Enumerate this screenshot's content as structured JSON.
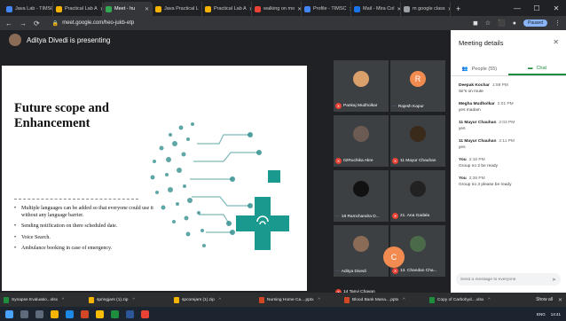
{
  "browser": {
    "tabs": [
      {
        "label": "Java Lab - TIMSC",
        "color": "#4285f4"
      },
      {
        "label": "Practical Lab A",
        "color": "#f4b400"
      },
      {
        "label": "Meet - hu",
        "color": "#34a853",
        "active": true
      },
      {
        "label": "Java Practical L",
        "color": "#f4b400"
      },
      {
        "label": "Practical Lab A",
        "color": "#f4b400"
      },
      {
        "label": "walking on mo",
        "color": "#ea4335"
      },
      {
        "label": "Profile - TIMSC",
        "color": "#4285f4"
      },
      {
        "label": "Mail - Mira Col",
        "color": "#1a73e8"
      },
      {
        "label": "m google class",
        "color": "#9aa0a6"
      }
    ],
    "url": "meet.google.com/heo-jukb-etp",
    "paused_label": "Paused"
  },
  "meeting": {
    "presenter_text": "Aditya Divedi is presenting"
  },
  "slide": {
    "title": "Future scope and Enhancement",
    "bullets": [
      "Multiple languages can be added so that everyone could use it without any language barrier.",
      "Sending notification on there scheduled date.",
      "Voice Search.",
      "Ambulance booking in case of emergency."
    ]
  },
  "participants": [
    {
      "name": "Pankaj Mudholkar",
      "avatar_color": "#d9a06b",
      "muted": true
    },
    {
      "name": "Rajesh Kapur",
      "avatar_color": "#f28b50",
      "initial": "R",
      "muted": false
    },
    {
      "name": "02Ruchika Akre",
      "avatar_color": "#6b5b53",
      "muted": true
    },
    {
      "name": "11 Mayur Chauhan",
      "avatar_color": "#3a2a1a",
      "muted": true
    },
    {
      "name": "18 Ramchandra D...",
      "avatar_color": "#111111",
      "muted": false
    },
    {
      "name": "21. Ana Gadala",
      "avatar_color": "#222222",
      "muted": true
    },
    {
      "name": "Aditya Divedi",
      "avatar_color": "#8a6b55",
      "muted": false
    },
    {
      "name": "13. Chandan Cha...",
      "avatar_color": "#4a6a4a",
      "muted": true
    },
    {
      "name": "14 Tanvi Chavan",
      "avatar_color": "#f28b50",
      "initial": "C",
      "muted": true
    }
  ],
  "panel": {
    "title": "Meeting details",
    "people_tab": "People (55)",
    "chat_tab": "Chat",
    "messages": [
      {
        "sender": "Deepak Kochar",
        "time": "1:59 PM",
        "text": "Sir's on mute"
      },
      {
        "sender": "Megha Mudholkar",
        "time": "2:01 PM",
        "text": "yes madam"
      },
      {
        "sender": "11 Mayur Chauhan",
        "time": "2:03 PM",
        "text": "yes"
      },
      {
        "sender": "11 Mayur Chauhan",
        "time": "2:11 PM",
        "text": "yes"
      },
      {
        "sender": "You",
        "time": "2:16 PM",
        "text": "Group no 2 be ready"
      },
      {
        "sender": "You",
        "time": "2:36 PM",
        "text": "Group no 3 please be ready"
      }
    ],
    "compose_placeholder": "Send a message to everyone"
  },
  "downloads": {
    "items": [
      {
        "name": "Synapse Evaluatio...xlsx",
        "color": "#1e8e3e"
      },
      {
        "name": "springjars (1).zip",
        "color": "#f4b400"
      },
      {
        "name": "spcorejars (1).zip",
        "color": "#f4b400"
      },
      {
        "name": "Nursing Home Ca....pptx",
        "color": "#d24726"
      },
      {
        "name": "Blood Bank Mana....pptx",
        "color": "#d24726"
      },
      {
        "name": "Copy of Carbohyd....xlsx",
        "color": "#1e8e3e"
      }
    ],
    "show_all": "Show all"
  },
  "taskbar": {
    "clock": "14:41",
    "lang": "ENG"
  },
  "colors": {
    "chat_accent": "#1e8e3e",
    "mute_red": "#ea4335"
  }
}
